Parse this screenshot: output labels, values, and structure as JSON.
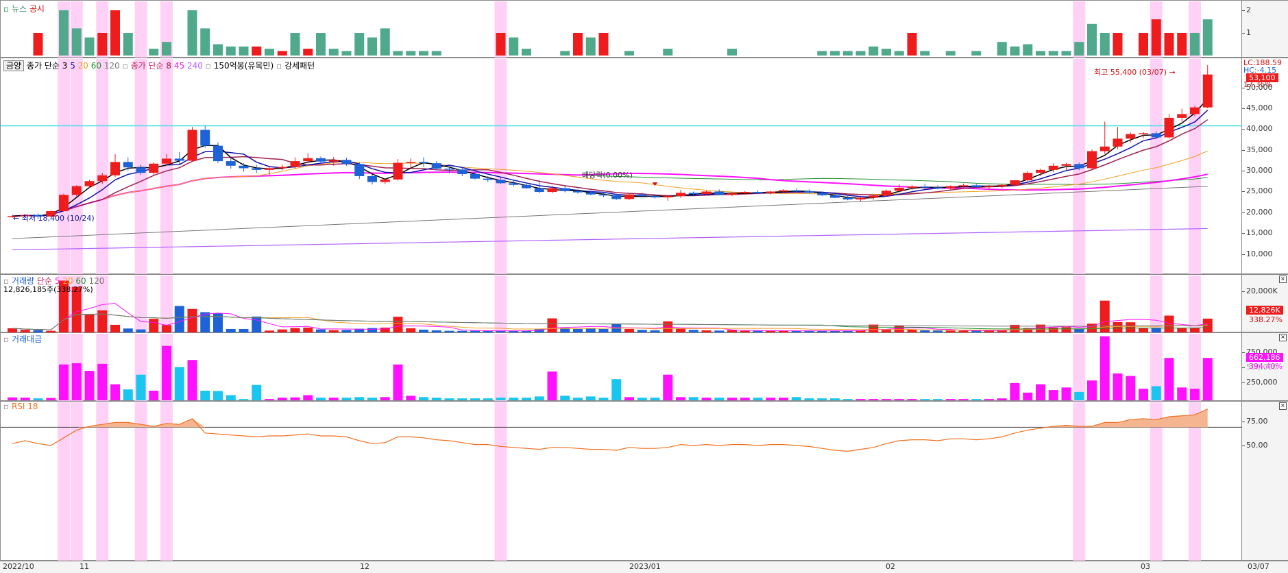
{
  "colors": {
    "up": "#ee1c1c",
    "down": "#1e62d8",
    "highlight": "#ffc9f5",
    "news": "#4fa98a",
    "ma3": "#000000",
    "ma5": "#1010b0",
    "ma20": "#f0a020",
    "ma60": "#209030",
    "ma120": "#777777",
    "ma8": "#a02050",
    "ma45": "#ff10ff",
    "ma240": "#b060ff",
    "volTeal": "#19c6f0",
    "volMagenta": "#ff10ff",
    "rsi": "#f07020",
    "rsiFill": "#f6b591",
    "hline": "#40e0e8"
  },
  "news_panel": {
    "label_news": "뉴스",
    "label_disclosure": "공시",
    "ticks": [
      "2",
      "1"
    ]
  },
  "price_panel": {
    "legend": {
      "toggle": "금양",
      "ma_a_title": "종가 단순",
      "ma_a_periods": [
        "3",
        "5",
        "20",
        "60",
        "120"
      ],
      "ma_b_title": "종가 단순",
      "ma_b_periods": [
        "8",
        "45",
        "240"
      ],
      "extra1": "150억봉(유목민)",
      "extra2": "강세패턴"
    },
    "ticks": [
      "50,000",
      "45,000",
      "40,000",
      "35,000",
      "30,000",
      "25,000",
      "20,000",
      "15,000",
      "10,000"
    ],
    "lc": "LC:188.59",
    "hc": "HC:-4.15",
    "current": "53,100",
    "pct": "17.35%",
    "high_label": "최고 55,400 (03/07)",
    "low_label": "최저 18,400 (10/24)",
    "dividend_label": "배당락(0.00%)"
  },
  "volume_panel": {
    "label": "거래량",
    "ma_title": "단순",
    "ma_periods": [
      "5",
      "20",
      "60",
      "120"
    ],
    "sub": "12,826,185주(338.27%)",
    "ticks": [
      "20,000K"
    ],
    "current": "12,826K",
    "pct": "338.27%"
  },
  "value_panel": {
    "label": "거래대금",
    "ticks": [
      "750,000",
      "500,000",
      "250,000"
    ],
    "current": "662,186",
    "pct": "394.40%"
  },
  "rsi_panel": {
    "label": "RSI 18",
    "ticks": [
      "75.00",
      "50.00"
    ]
  },
  "x_axis": {
    "labels": [
      "2022/10",
      "11",
      "12",
      "2023/01",
      "02",
      "03",
      "03/07"
    ]
  },
  "chart_data": {
    "type": "candlestick",
    "dates": [
      "10/20",
      "10/21",
      "10/24",
      "10/25",
      "10/26",
      "10/27",
      "10/28",
      "10/31",
      "11/01",
      "11/02",
      "11/03",
      "11/04",
      "11/07",
      "11/08",
      "11/09",
      "11/10",
      "11/11",
      "11/14",
      "11/15",
      "11/16",
      "11/17",
      "11/18",
      "11/21",
      "11/22",
      "11/23",
      "11/24",
      "11/25",
      "11/28",
      "11/29",
      "11/30",
      "12/01",
      "12/02",
      "12/05",
      "12/06",
      "12/07",
      "12/08",
      "12/09",
      "12/12",
      "12/13",
      "12/14",
      "12/15",
      "12/16",
      "12/19",
      "12/20",
      "12/21",
      "12/22",
      "12/23",
      "12/26",
      "12/27",
      "12/28",
      "01/02",
      "01/03",
      "01/04",
      "01/05",
      "01/06",
      "01/09",
      "01/10",
      "01/11",
      "01/12",
      "01/13",
      "01/16",
      "01/17",
      "01/18",
      "01/19",
      "01/20",
      "01/25",
      "01/26",
      "01/27",
      "01/30",
      "01/31",
      "02/01",
      "02/02",
      "02/03",
      "02/06",
      "02/07",
      "02/08",
      "02/09",
      "02/10",
      "02/13",
      "02/14",
      "02/15",
      "02/16",
      "02/17",
      "02/20",
      "02/21",
      "02/22",
      "02/23",
      "02/24",
      "02/27",
      "02/28",
      "03/02",
      "03/03",
      "03/06",
      "03/07"
    ],
    "candles": [
      [
        19000,
        19400,
        18700,
        19100
      ],
      [
        19100,
        19600,
        18800,
        19400
      ],
      [
        19400,
        19700,
        18400,
        19000
      ],
      [
        19000,
        20500,
        18900,
        20300
      ],
      [
        20300,
        24500,
        20200,
        24200
      ],
      [
        24200,
        26500,
        23800,
        26300
      ],
      [
        26300,
        27800,
        25800,
        27500
      ],
      [
        27500,
        29500,
        26800,
        28900
      ],
      [
        28900,
        34000,
        28500,
        32100
      ],
      [
        32100,
        33200,
        30000,
        30800
      ],
      [
        30800,
        31500,
        29000,
        29500
      ],
      [
        29500,
        32000,
        29000,
        31700
      ],
      [
        31700,
        34000,
        31200,
        32900
      ],
      [
        32900,
        34500,
        31500,
        32400
      ],
      [
        32400,
        40500,
        32200,
        39800
      ],
      [
        39800,
        40800,
        35500,
        36000
      ],
      [
        36000,
        36800,
        31800,
        32300
      ],
      [
        32300,
        33200,
        30500,
        31200
      ],
      [
        31200,
        31800,
        29800,
        30600
      ],
      [
        30600,
        31400,
        29500,
        30200
      ],
      [
        30200,
        30900,
        29000,
        30600
      ],
      [
        30600,
        31500,
        30100,
        30900
      ],
      [
        30900,
        33200,
        30500,
        32300
      ],
      [
        32300,
        34200,
        31800,
        33000
      ],
      [
        33000,
        33400,
        31700,
        32200
      ],
      [
        32200,
        33300,
        31200,
        32600
      ],
      [
        32600,
        33100,
        31200,
        31600
      ],
      [
        31600,
        32000,
        28000,
        28700
      ],
      [
        28700,
        29000,
        26700,
        27300
      ],
      [
        27300,
        28000,
        26800,
        27900
      ],
      [
        27900,
        32800,
        27600,
        31900
      ],
      [
        31900,
        33000,
        30500,
        32100
      ],
      [
        32100,
        33200,
        31000,
        31800
      ],
      [
        31800,
        32300,
        30100,
        30500
      ],
      [
        30500,
        31100,
        29400,
        30300
      ],
      [
        30300,
        30800,
        28700,
        29200
      ],
      [
        29200,
        29600,
        27900,
        28100
      ],
      [
        28100,
        28700,
        27300,
        27800
      ],
      [
        27800,
        28400,
        26800,
        27000
      ],
      [
        27000,
        27600,
        26200,
        26600
      ],
      [
        26600,
        27100,
        25600,
        25800
      ],
      [
        25800,
        27800,
        24600,
        24900
      ],
      [
        24900,
        26400,
        24600,
        25800
      ],
      [
        25800,
        26300,
        24800,
        25100
      ],
      [
        25100,
        25600,
        24500,
        24800
      ],
      [
        24800,
        25300,
        24100,
        24300
      ],
      [
        24300,
        24800,
        23600,
        24100
      ],
      [
        24100,
        24500,
        23000,
        23200
      ],
      [
        23200,
        24600,
        23000,
        24300
      ],
      [
        24300,
        24700,
        23700,
        23900
      ],
      [
        23900,
        24400,
        23300,
        23600
      ],
      [
        23600,
        24200,
        22800,
        23900
      ],
      [
        23900,
        25400,
        23500,
        24700
      ],
      [
        24700,
        25000,
        24100,
        24400
      ],
      [
        24400,
        25200,
        24200,
        25000
      ],
      [
        25000,
        25500,
        24100,
        24200
      ],
      [
        24200,
        24800,
        23900,
        24600
      ],
      [
        24600,
        25100,
        24200,
        24900
      ],
      [
        24900,
        25300,
        24400,
        24600
      ],
      [
        24600,
        25200,
        24300,
        25000
      ],
      [
        25000,
        25600,
        24700,
        25300
      ],
      [
        25300,
        25700,
        24800,
        25100
      ],
      [
        25100,
        25500,
        24500,
        24700
      ],
      [
        24700,
        25000,
        23900,
        24100
      ],
      [
        24100,
        24500,
        23400,
        23500
      ],
      [
        23500,
        23900,
        22900,
        23100
      ],
      [
        23100,
        23700,
        22700,
        23500
      ],
      [
        23500,
        24100,
        23100,
        24000
      ],
      [
        24000,
        25500,
        23800,
        25200
      ],
      [
        25200,
        26800,
        24800,
        25900
      ],
      [
        25900,
        26600,
        25400,
        26200
      ],
      [
        26200,
        26900,
        25600,
        26000
      ],
      [
        26000,
        26500,
        25500,
        25800
      ],
      [
        25800,
        26500,
        25500,
        26300
      ],
      [
        26300,
        26900,
        25800,
        26500
      ],
      [
        26500,
        26800,
        25800,
        26100
      ],
      [
        26100,
        26600,
        25700,
        26300
      ],
      [
        26300,
        26800,
        25900,
        26600
      ],
      [
        26600,
        27800,
        26300,
        27700
      ],
      [
        27700,
        29900,
        27400,
        29500
      ],
      [
        29500,
        30500,
        28700,
        30200
      ],
      [
        30200,
        31800,
        29600,
        31200
      ],
      [
        31200,
        31900,
        30200,
        31600
      ],
      [
        31600,
        32000,
        30100,
        30600
      ],
      [
        30600,
        35100,
        30400,
        34700
      ],
      [
        34700,
        41800,
        34000,
        35800
      ],
      [
        35800,
        40500,
        35200,
        37700
      ],
      [
        37700,
        39200,
        36800,
        38800
      ],
      [
        38800,
        39300,
        37800,
        39000
      ],
      [
        39000,
        39500,
        37900,
        38000
      ],
      [
        38000,
        43600,
        37700,
        42700
      ],
      [
        42700,
        44900,
        41800,
        43600
      ],
      [
        43600,
        45600,
        43000,
        45200
      ],
      [
        45200,
        55400,
        45000,
        53100
      ]
    ],
    "volumes_k": [
      1800,
      1100,
      1050,
      700,
      22500,
      19800,
      7800,
      9600,
      3300,
      1700,
      1300,
      5900,
      3200,
      11500,
      10200,
      8800,
      8300,
      1500,
      1500,
      6900,
      800,
      1300,
      1900,
      2100,
      1300,
      1000,
      1100,
      1600,
      1900,
      2100,
      6800,
      1800,
      1200,
      900,
      700,
      700,
      700,
      700,
      700,
      700,
      700,
      1500,
      6100,
      1900,
      1500,
      1800,
      1500,
      3700,
      1500,
      1100,
      900,
      4800,
      1700,
      1100,
      900,
      800,
      1000,
      700,
      700,
      700,
      700,
      700,
      700,
      700,
      700,
      700,
      900,
      3400,
      1200,
      2900,
      1200,
      900,
      800,
      800,
      800,
      800,
      800,
      900,
      3300,
      1900,
      3400,
      2100,
      2300,
      1500,
      3800,
      13800,
      4500,
      4400,
      1800,
      2000,
      7300,
      1800,
      1800,
      6000
    ],
    "values_m": [
      45000,
      40000,
      30000,
      36000,
      560000,
      580000,
      460000,
      570000,
      250000,
      170000,
      400000,
      150000,
      850000,
      520000,
      630000,
      150000,
      145000,
      80000,
      20000,
      240000,
      20000,
      40000,
      45000,
      80000,
      40000,
      40000,
      40000,
      50000,
      40000,
      50000,
      560000,
      70000,
      50000,
      40000,
      30000,
      30000,
      30000,
      30000,
      40000,
      40000,
      40000,
      60000,
      450000,
      70000,
      40000,
      60000,
      40000,
      330000,
      50000,
      40000,
      40000,
      400000,
      50000,
      50000,
      40000,
      40000,
      40000,
      40000,
      40000,
      40000,
      40000,
      50000,
      30000,
      30000,
      30000,
      20000,
      20000,
      20000,
      20000,
      20000,
      20000,
      20000,
      20000,
      20000,
      20000,
      20000,
      20000,
      30000,
      270000,
      120000,
      250000,
      160000,
      200000,
      130000,
      310000,
      1000000,
      420000,
      380000,
      180000,
      220000,
      662186,
      200000,
      180000,
      662186
    ],
    "rsi": [
      52,
      55,
      52,
      50,
      58,
      66,
      70,
      72,
      74,
      74,
      72,
      70,
      73,
      72,
      78,
      63,
      62,
      61,
      60,
      59,
      60,
      60,
      61,
      62,
      60,
      60,
      59,
      55,
      52,
      53,
      59,
      59,
      58,
      56,
      55,
      53,
      51,
      51,
      49,
      48,
      47,
      46,
      48,
      48,
      47,
      46,
      46,
      45,
      48,
      47,
      47,
      48,
      51,
      50,
      51,
      50,
      51,
      51,
      50,
      51,
      51,
      50,
      49,
      47,
      45,
      44,
      46,
      48,
      52,
      55,
      56,
      56,
      55,
      57,
      57,
      56,
      57,
      59,
      63,
      66,
      68,
      70,
      71,
      70,
      70,
      74,
      74,
      77,
      78,
      77,
      80,
      81,
      82,
      88
    ],
    "highlight_indices": [
      4,
      5,
      7,
      10,
      12,
      38,
      83,
      89,
      92
    ],
    "ylim": [
      5000,
      57000
    ]
  }
}
